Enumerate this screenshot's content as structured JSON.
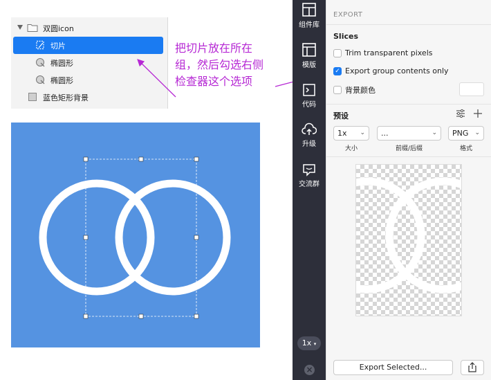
{
  "layers": {
    "group_name": "双圆icon",
    "items": [
      {
        "label": "切片",
        "selected": true,
        "icon": "slice-icon"
      },
      {
        "label": "椭圆形",
        "selected": false,
        "icon": "oval-icon"
      },
      {
        "label": "椭圆形",
        "selected": false,
        "icon": "oval-icon"
      },
      {
        "label": "蓝色矩形背景",
        "selected": false,
        "icon": "rectangle-icon"
      }
    ]
  },
  "annotation": {
    "lines": [
      "把切片放在所在",
      "组，然后勾选右侧",
      "检查器这个选项"
    ],
    "color": "#b628d4"
  },
  "canvas": {
    "background": "#5593e1",
    "shape_color": "#ffffff"
  },
  "toolbar": {
    "items": [
      {
        "label": "组件库",
        "icon": "component-library-icon"
      },
      {
        "label": "模版",
        "icon": "template-icon"
      },
      {
        "label": "代码",
        "icon": "code-icon"
      },
      {
        "label": "升级",
        "icon": "upgrade-cloud-icon"
      },
      {
        "label": "交流群",
        "icon": "chat-group-icon"
      }
    ],
    "zoom": "1x",
    "background": "#2d2f3a"
  },
  "inspector": {
    "title": "EXPORT",
    "slices_title": "Slices",
    "options": [
      {
        "label": "Trim transparent pixels",
        "checked": false
      },
      {
        "label": "Export group contents only",
        "checked": true
      },
      {
        "label": "背景颜色",
        "checked": false
      }
    ],
    "presets_title": "预设",
    "scale": {
      "value": "1x",
      "label": "大小"
    },
    "prefix": {
      "value": "...",
      "label": "前缀/后缀"
    },
    "format": {
      "value": "PNG",
      "label": "格式"
    },
    "export_button": "Export Selected...",
    "accent": "#1a7bf2"
  }
}
